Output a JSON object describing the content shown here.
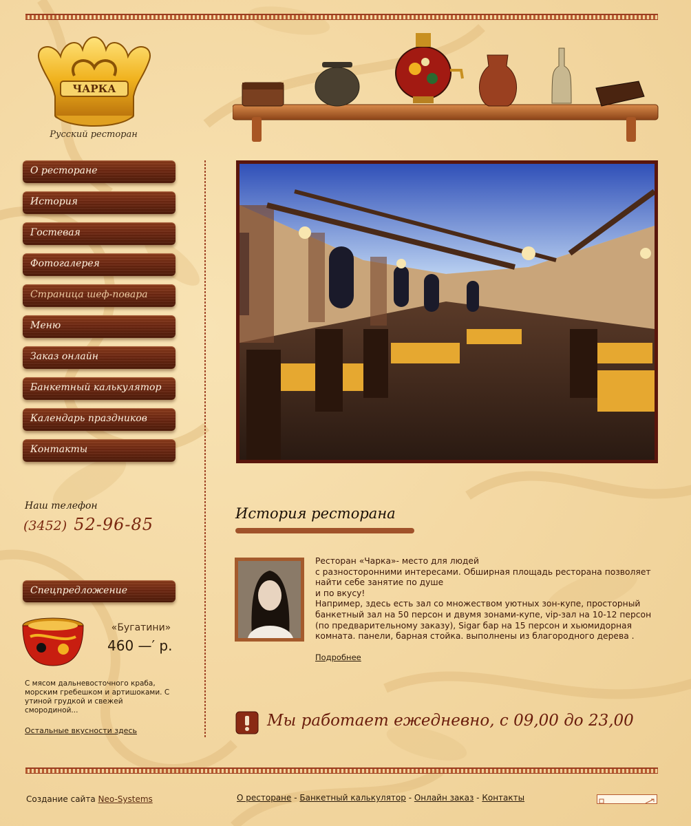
{
  "logo": {
    "brand": "ЧАРКА",
    "subtitle": "Русский ресторан"
  },
  "nav": {
    "items": [
      {
        "label": "О ресторане"
      },
      {
        "label": "История"
      },
      {
        "label": "Гостевая"
      },
      {
        "label": "Фотогалерея"
      },
      {
        "label": "Страница шеф-повара",
        "active": true
      },
      {
        "label": "Меню"
      },
      {
        "label": "Заказ онлайн"
      },
      {
        "label": "Банкетный калькулятор"
      },
      {
        "label": "Календарь праздников"
      },
      {
        "label": "Контакты"
      }
    ]
  },
  "contact": {
    "phone_label": "Наш телефон",
    "phone_code": "(3452)",
    "phone_number": "52-96-85"
  },
  "special": {
    "button_label": "Спецпредложение",
    "dish_name": "«Бугатини»",
    "dish_price": "460 —′ р.",
    "description": "С мясом дальневосточного краба, морским гребешком и артишоками. С утиной грудкой и свежей смородиной...",
    "more_link": "Остальные вкусности здесь"
  },
  "main": {
    "section_title": "История ресторана",
    "article_lines": [
      "Ресторан «Чарка»- место для людей",
      "с разносторонними интересами. Обширная площадь ресторана позволяет найти себе занятие по душе",
      "и по вкусу!",
      "Например, здесь есть  зал со множеством уютных зон-купе, просторный банкетный зал на 50 персон и двумя зонами-купе, vip-зал на 10-12 персон (по предварительному заказу), Sigar бар на 15 персон и хьюмидорная комната. панели, барная стойка. выполнены из благородного дерева ."
    ],
    "read_more": "Подробнее",
    "hours": "Мы работает ежедневно, с 09,00 до 23,00"
  },
  "footer": {
    "credit_prefix": "Создание сайта",
    "credit_link": "Neo-Systems",
    "links": [
      "О ресторане",
      "Банкетный калькулятор",
      "Онлайн заказ",
      "Контакты"
    ],
    "separator": " - "
  },
  "colors": {
    "accent": "#6e2812",
    "text": "#3a1608",
    "background": "#f4d9a4"
  }
}
